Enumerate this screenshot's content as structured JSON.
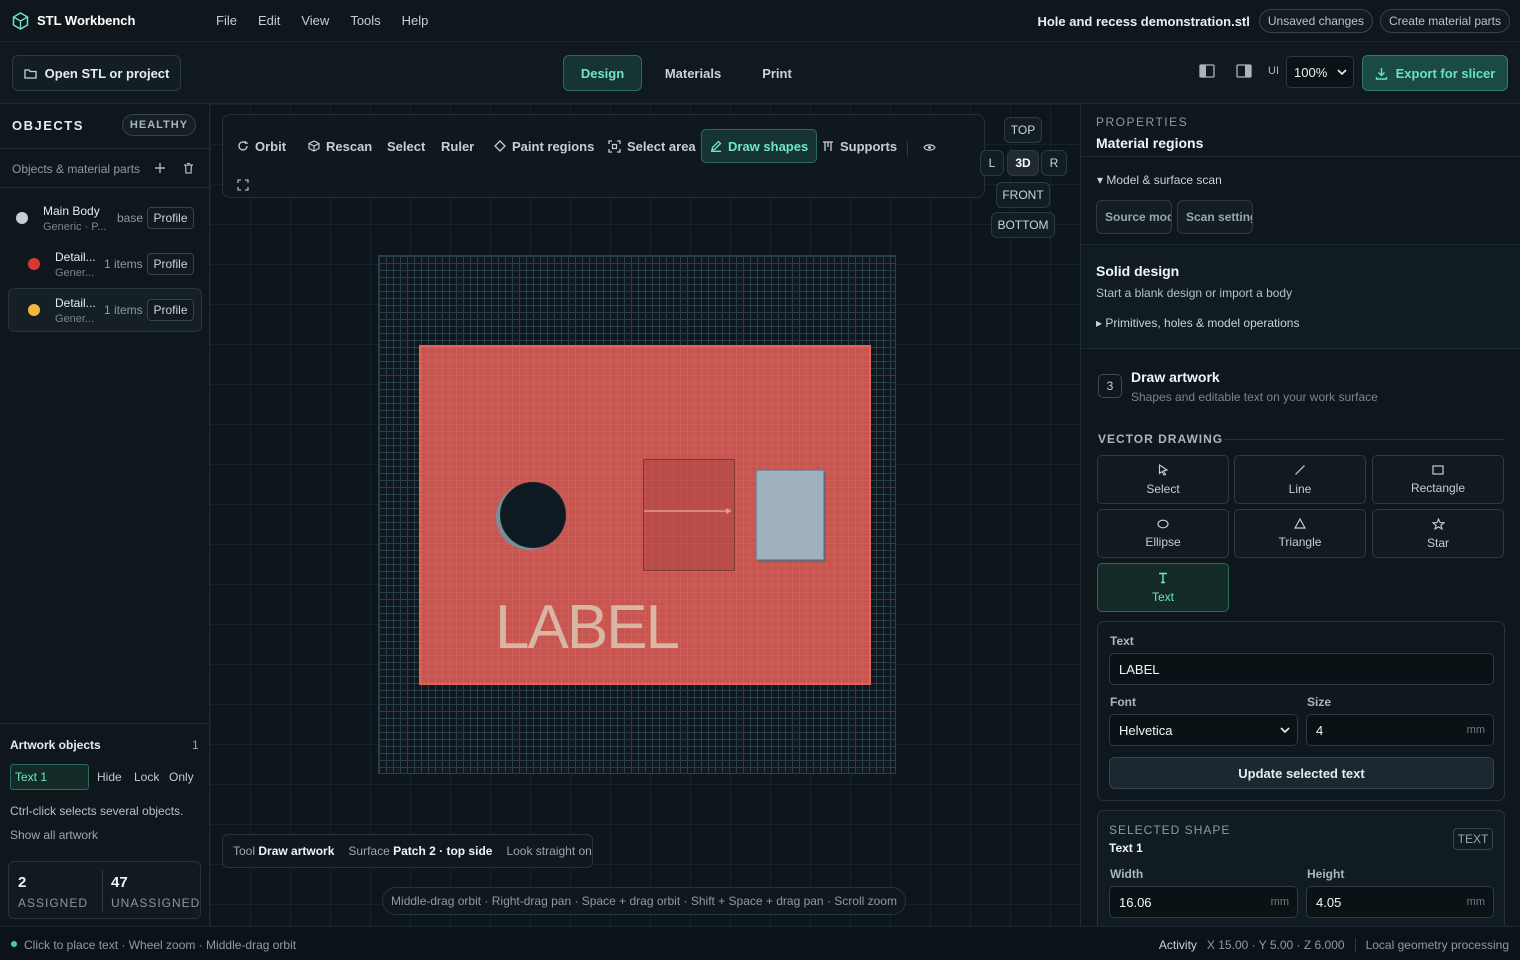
{
  "app": {
    "name": "STL Workbench"
  },
  "menu": [
    "File",
    "Edit",
    "View",
    "Tools",
    "Help"
  ],
  "document": {
    "title": "Hole and recess demonstration.stl",
    "status": "Unsaved changes",
    "action": "Create material parts"
  },
  "toolbar": {
    "open": "Open STL or project",
    "modes": [
      "Design",
      "Materials",
      "Print"
    ],
    "ui_label": "UI",
    "zoom": "100%",
    "export": "Export for slicer"
  },
  "objects": {
    "title": "OBJECTS",
    "health": "HEALTHY",
    "subtitle": "Objects & material parts",
    "items": [
      {
        "name": "Main Body",
        "meta": "Generic · P...",
        "count": "base",
        "profile": "Profile",
        "color": "#c9ced2"
      },
      {
        "name": "Detail...",
        "meta": "Gener...",
        "count": "1 items",
        "profile": "Profile",
        "color": "#d8382f"
      },
      {
        "name": "Detail...",
        "meta": "Gener...",
        "count": "1 items",
        "profile": "Profile",
        "color": "#f0b93b"
      }
    ]
  },
  "artwork": {
    "title": "Artwork objects",
    "count": "1",
    "item": "Text 1",
    "actions": [
      "Hide",
      "Lock",
      "Only"
    ],
    "hint": "Ctrl-click selects several objects.",
    "show_all": "Show all artwork",
    "assigned": {
      "value": "2",
      "label": "ASSIGNED"
    },
    "unassigned": {
      "value": "47",
      "label": "UNASSIGNED"
    }
  },
  "viewport": {
    "tools": [
      "Orbit",
      "Rescan",
      "Select",
      "Ruler",
      "Paint regions",
      "Select area",
      "Draw shapes",
      "Supports"
    ],
    "views": {
      "top": "TOP",
      "left": "L",
      "threed": "3D",
      "right": "R",
      "front": "FRONT",
      "bottom": "BOTTOM"
    },
    "artwork_text": "LABEL",
    "status": {
      "tool_label": "Tool",
      "tool": "Draw artwork",
      "surface_label": "Surface",
      "surface": "Patch 2 · top side",
      "look": "Look straight on"
    },
    "hint": "Middle-drag orbit · Right-drag pan · Space + drag orbit · Shift + Space + drag pan · Scroll zoom"
  },
  "properties": {
    "kicker": "PROPERTIES",
    "title": "Material regions",
    "scan_toggle": "▾ Model & surface scan",
    "source_btn": "Source model",
    "scan_btn": "Scan settings",
    "solid_title": "Solid design",
    "solid_sub": "Start a blank design or import a body",
    "prims_toggle": "▸ Primitives, holes & model operations",
    "step": "3",
    "draw_title": "Draw artwork",
    "draw_sub": "Shapes and editable text on your work surface",
    "vector_title": "VECTOR DRAWING",
    "shapes": [
      "Select",
      "Line",
      "Rectangle",
      "Ellipse",
      "Triangle",
      "Star",
      "Text"
    ],
    "text_label": "Text",
    "text_value": "LABEL",
    "font_label": "Font",
    "font_value": "Helvetica",
    "size_label": "Size",
    "size_value": "4",
    "unit": "mm",
    "update": "Update selected text",
    "selected_kicker": "SELECTED SHAPE",
    "selected_name": "Text 1",
    "selected_type": "TEXT",
    "width_label": "Width",
    "width_value": "16.06",
    "height_label": "Height",
    "height_value": "4.05"
  },
  "statusbar": {
    "message": "Click to place text · Wheel zoom · Middle-drag orbit",
    "activity": "Activity",
    "coords": "X 15.00 · Y 5.00 · Z 6.000",
    "processing": "Local geometry processing"
  },
  "colors": {
    "accent": "#6fe6c6",
    "surface": "#c8554f",
    "background": "#0d141a"
  }
}
